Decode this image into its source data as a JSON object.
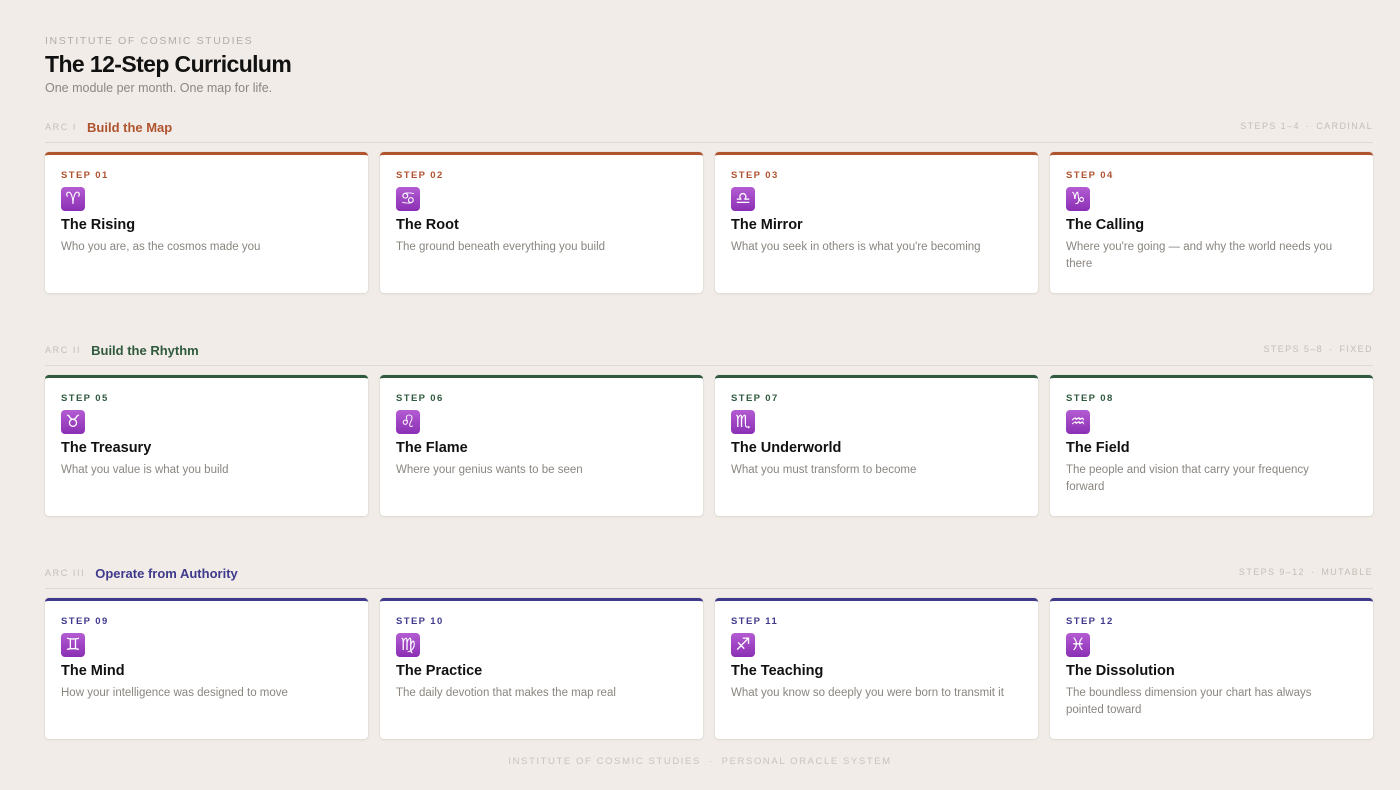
{
  "header": {
    "eyebrow": "INSTITUTE OF COSMIC STUDIES",
    "title": "The 12-Step Curriculum",
    "subtitle": "One module per month. One map for life."
  },
  "arcs": [
    {
      "number": "ARC I",
      "title": "Build the Map",
      "steps_range": "STEPS 1–4",
      "modality": "CARDINAL",
      "color": "#b0532f",
      "cards": [
        {
          "step": "STEP 01",
          "icon": "aries-icon",
          "glyph": "♈",
          "title": "The Rising",
          "desc": "Who you are, as the cosmos made you"
        },
        {
          "step": "STEP 02",
          "icon": "cancer-icon",
          "glyph": "♋",
          "title": "The Root",
          "desc": "The ground beneath everything you build"
        },
        {
          "step": "STEP 03",
          "icon": "libra-icon",
          "glyph": "♎",
          "title": "The Mirror",
          "desc": "What you seek in others is what you're becoming"
        },
        {
          "step": "STEP 04",
          "icon": "capricorn-icon",
          "glyph": "♑",
          "title": "The Calling",
          "desc": "Where you're going — and why the world needs you there"
        }
      ]
    },
    {
      "number": "ARC II",
      "title": "Build the Rhythm",
      "steps_range": "STEPS 5–8",
      "modality": "FIXED",
      "color": "#2f5a3e",
      "cards": [
        {
          "step": "STEP 05",
          "icon": "taurus-icon",
          "glyph": "♉",
          "title": "The Treasury",
          "desc": "What you value is what you build"
        },
        {
          "step": "STEP 06",
          "icon": "leo-icon",
          "glyph": "♌",
          "title": "The Flame",
          "desc": "Where your genius wants to be seen"
        },
        {
          "step": "STEP 07",
          "icon": "scorpio-icon",
          "glyph": "♏",
          "title": "The Underworld",
          "desc": "What you must transform to become"
        },
        {
          "step": "STEP 08",
          "icon": "aquarius-icon",
          "glyph": "♒",
          "title": "The Field",
          "desc": "The people and vision that carry your frequency forward"
        }
      ]
    },
    {
      "number": "ARC III",
      "title": "Operate from Authority",
      "steps_range": "STEPS 9–12",
      "modality": "MUTABLE",
      "color": "#3f3a8c",
      "cards": [
        {
          "step": "STEP 09",
          "icon": "gemini-icon",
          "glyph": "♊",
          "title": "The Mind",
          "desc": "How your intelligence was designed to move"
        },
        {
          "step": "STEP 10",
          "icon": "virgo-icon",
          "glyph": "♍",
          "title": "The Practice",
          "desc": "The daily devotion that makes the map real"
        },
        {
          "step": "STEP 11",
          "icon": "sagittarius-icon",
          "glyph": "♐",
          "title": "The Teaching",
          "desc": "What you know so deeply you were born to transmit it"
        },
        {
          "step": "STEP 12",
          "icon": "pisces-icon",
          "glyph": "♓",
          "title": "The Dissolution",
          "desc": "The boundless dimension your chart has always pointed toward"
        }
      ]
    }
  ],
  "footer": {
    "left": "INSTITUTE OF COSMIC STUDIES",
    "separator": "·",
    "right": "PERSONAL ORACLE SYSTEM"
  }
}
